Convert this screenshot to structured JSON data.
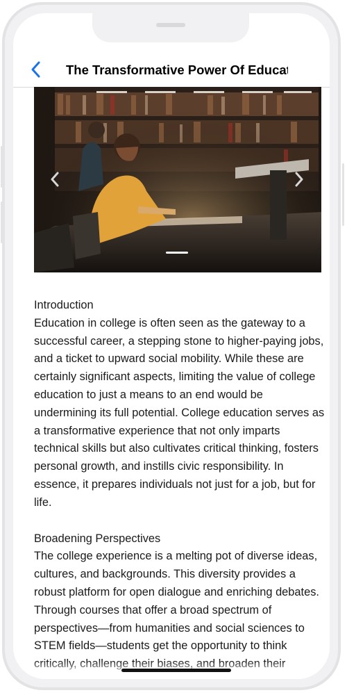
{
  "navbar": {
    "title": "The Transformative Power Of Educati",
    "back_icon": "chevron-left-icon",
    "accent_color": "#1a73e8"
  },
  "carousel": {
    "image_description_icon": "photo",
    "prev_icon": "chevron-left-icon",
    "next_icon": "chevron-right-icon"
  },
  "article": {
    "intro_heading": "Introduction",
    "intro_body": "Education in college is often seen as the gateway to a successful career, a stepping stone to higher-paying jobs, and a ticket to upward social mobility. While these are certainly significant aspects, limiting the value of college education to just a means to an end would be undermining its full potential. College education serves as a transformative experience that not only imparts technical skills but also cultivates critical thinking, fosters personal growth, and instills civic responsibility. In essence, it prepares individuals not just for a job, but for life.",
    "section2_heading": "Broadening Perspectives",
    "section2_body": "The college experience is a melting pot of diverse ideas, cultures, and backgrounds. This diversity provides a robust platform for open dialogue and enriching debates. Through courses that offer a broad spectrum of perspectives—from humanities and social sciences to STEM fields—students get the opportunity to think critically, challenge their biases, and broaden their worldview. The interpersonal skills"
  }
}
